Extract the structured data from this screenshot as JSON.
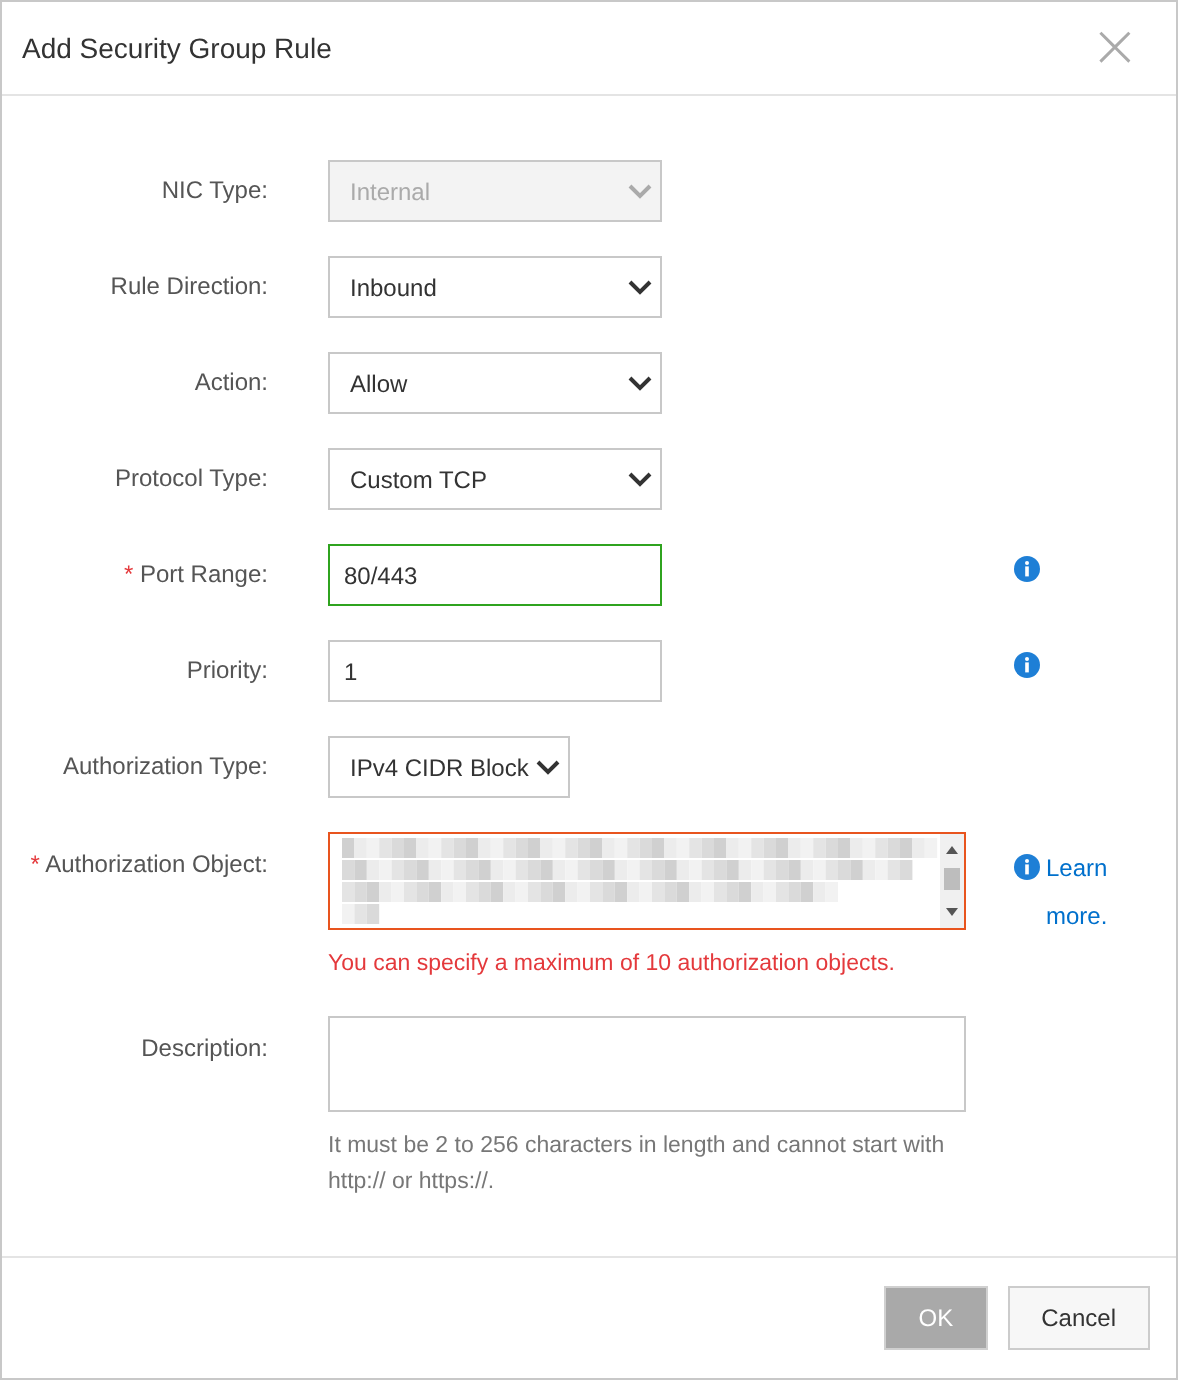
{
  "dialog": {
    "title": "Add Security Group Rule",
    "close_icon": "×"
  },
  "fields": [
    {
      "kind": "select",
      "label": "NIC Type:",
      "value": "Internal",
      "disabled": true,
      "narrow": false
    },
    {
      "kind": "select",
      "label": "Rule Direction:",
      "value": "Inbound",
      "disabled": false,
      "narrow": false
    },
    {
      "kind": "select",
      "label": "Action:",
      "value": "Allow",
      "disabled": false,
      "narrow": false
    },
    {
      "kind": "select",
      "label": "Protocol Type:",
      "value": "Custom TCP",
      "disabled": false,
      "narrow": false
    },
    {
      "kind": "input",
      "required_mark": "*",
      "label": "Port Range:",
      "value": "80/443",
      "valid": true,
      "info": true
    },
    {
      "kind": "input",
      "label": "Priority:",
      "value": "1",
      "valid": false,
      "info": true
    },
    {
      "kind": "select",
      "label": "Authorization Type:",
      "value": "IPv4 CIDR Block",
      "disabled": false,
      "narrow": true
    },
    {
      "kind": "textarea",
      "required_mark": "*",
      "label": "Authorization Object:",
      "redacted": true,
      "error": true,
      "help_link": "Learn more.",
      "message": "You can specify a maximum of 10 authorization objects."
    },
    {
      "kind": "textarea",
      "label": "Description:",
      "redacted": false,
      "error": false,
      "message": "It must be 2 to 256 characters in length and cannot start with http:// or https://."
    }
  ],
  "buttons": [
    {
      "label": "OK",
      "disabled": true
    },
    {
      "label": "Cancel",
      "disabled": false
    }
  ]
}
